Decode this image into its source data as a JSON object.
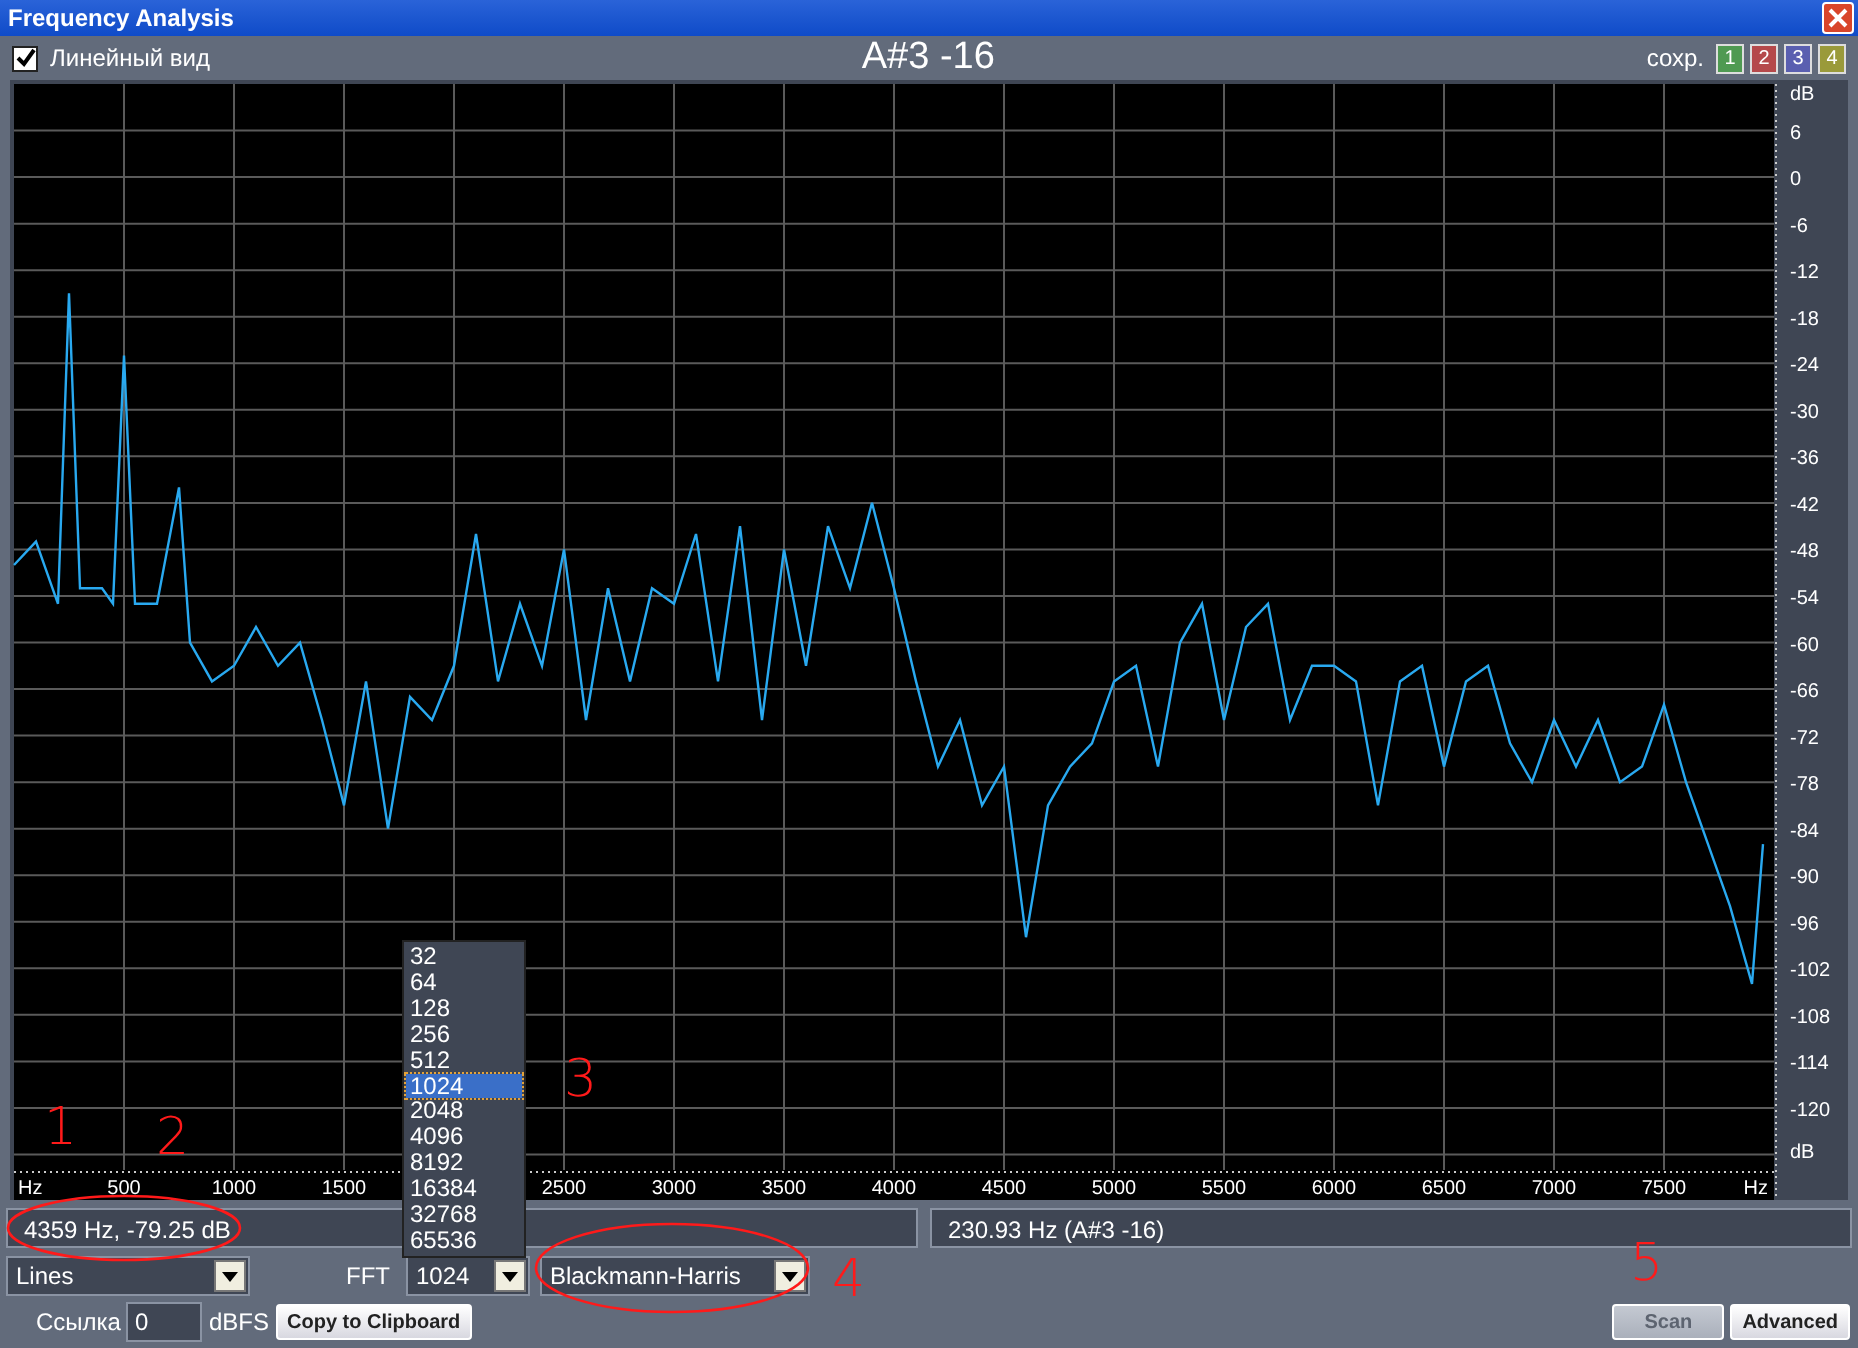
{
  "window": {
    "title": "Frequency Analysis"
  },
  "toolbar": {
    "linear_view": {
      "label": "Линейный вид",
      "checked": true
    },
    "note": "A#3 -16",
    "save_label": "сохр.",
    "slots": [
      {
        "label": "1",
        "color": "#4f9a52"
      },
      {
        "label": "2",
        "color": "#b5494b"
      },
      {
        "label": "3",
        "color": "#5a5fb0"
      },
      {
        "label": "4",
        "color": "#9a9a3a"
      }
    ]
  },
  "spectrum": {
    "scale_labels": [
      "dB",
      "dB",
      "Hz",
      "Hz"
    ],
    "chart_data": {
      "type": "line",
      "xlim": [
        0,
        8000
      ],
      "ylim": [
        -128,
        12
      ],
      "grid": true,
      "xticks": [
        500,
        1000,
        1500,
        2500,
        3000,
        3500,
        4000,
        4500,
        5000,
        5500,
        6000,
        6500,
        7000,
        7500
      ],
      "yticks": [
        6,
        0,
        -6,
        -12,
        -18,
        -24,
        -30,
        -36,
        -42,
        -48,
        -54,
        -60,
        -66,
        -72,
        -78,
        -84,
        -90,
        -96,
        -102,
        -108,
        -114,
        -120
      ],
      "x": [
        0,
        100,
        200,
        250,
        300,
        400,
        450,
        500,
        550,
        650,
        750,
        800,
        900,
        1000,
        1100,
        1200,
        1300,
        1400,
        1500,
        1600,
        1700,
        1800,
        1900,
        2000,
        2100,
        2200,
        2300,
        2400,
        2500,
        2600,
        2700,
        2800,
        2900,
        3000,
        3100,
        3200,
        3300,
        3400,
        3500,
        3600,
        3700,
        3800,
        3900,
        4000,
        4100,
        4200,
        4300,
        4400,
        4500,
        4600,
        4700,
        4800,
        4900,
        5000,
        5100,
        5200,
        5300,
        5400,
        5500,
        5600,
        5700,
        5800,
        5900,
        6000,
        6100,
        6200,
        6300,
        6400,
        6500,
        6600,
        6700,
        6800,
        6900,
        7000,
        7100,
        7200,
        7300,
        7400,
        7500,
        7600,
        7700,
        7800,
        7900,
        7950
      ],
      "series": [
        {
          "color": "#29a9f0",
          "values": [
            -50,
            -47,
            -55,
            -15,
            -53,
            -53,
            -55,
            -23,
            -55,
            -55,
            -40,
            -60,
            -65,
            -63,
            -58,
            -63,
            -60,
            -70,
            -81,
            -65,
            -84,
            -67,
            -70,
            -63,
            -46,
            -65,
            -55,
            -63,
            -48,
            -70,
            -53,
            -65,
            -53,
            -55,
            -46,
            -65,
            -45,
            -70,
            -48,
            -63,
            -45,
            -53,
            -42,
            -53,
            -65,
            -76,
            -70,
            -81,
            -76,
            -98,
            -81,
            -76,
            -73,
            -65,
            -63,
            -76,
            -60,
            -55,
            -70,
            -58,
            -55,
            -70,
            -63,
            -63,
            -65,
            -81,
            -65,
            -63,
            -76,
            -65,
            -63,
            -73,
            -78,
            -70,
            -76,
            -70,
            -78,
            -76,
            -68,
            -78,
            -86,
            -94,
            -104,
            -86
          ]
        }
      ]
    }
  },
  "status": {
    "cursor": "4359 Hz, -79.25 dB",
    "peak": "230.93 Hz (A#3 -16)"
  },
  "controls": {
    "display_mode": "Lines",
    "fft_label": "FFT",
    "fft_size": "1024",
    "fft_options": [
      {
        "label": "32",
        "selected": false
      },
      {
        "label": "64",
        "selected": false
      },
      {
        "label": "128",
        "selected": false
      },
      {
        "label": "256",
        "selected": false
      },
      {
        "label": "512",
        "selected": false
      },
      {
        "label": "1024",
        "selected": true
      },
      {
        "label": "2048",
        "selected": false
      },
      {
        "label": "4096",
        "selected": false
      },
      {
        "label": "8192",
        "selected": false
      },
      {
        "label": "16384",
        "selected": false
      },
      {
        "label": "32768",
        "selected": false
      },
      {
        "label": "65536",
        "selected": false
      }
    ],
    "window_function": "Blackmann-Harris",
    "reference_label": "Ссылка",
    "reference_value": "0",
    "reference_unit": "dBFS",
    "copy_button": "Copy to Clipboard",
    "buttons": [
      {
        "label": "Scan",
        "disabled": true
      },
      {
        "label": "Advanced",
        "disabled": false
      }
    ]
  },
  "annotations": [
    {
      "label": "1"
    },
    {
      "label": "2"
    },
    {
      "label": "3"
    },
    {
      "label": "4"
    },
    {
      "label": "5"
    }
  ]
}
